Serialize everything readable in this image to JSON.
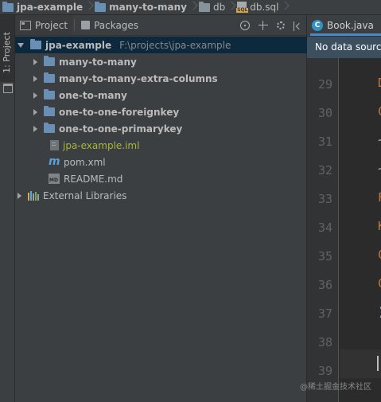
{
  "breadcrumb": {
    "items": [
      {
        "label": "jpa-example",
        "icon": "folder-icon",
        "bold": true
      },
      {
        "label": "many-to-many",
        "icon": "folder-icon",
        "bold": true
      },
      {
        "label": "db",
        "icon": "folder-icon",
        "bold": false
      },
      {
        "label": "db.sql",
        "icon": "sql-file-icon",
        "bold": false
      }
    ]
  },
  "left_stripe": {
    "project_label": "1: Project"
  },
  "project_panel": {
    "tabs": [
      {
        "label": "Project",
        "icon": "project-icon",
        "selected": true
      },
      {
        "label": "Packages",
        "icon": "packages-icon",
        "selected": false
      }
    ],
    "toolbar_icons": [
      "scroll-from-source-icon",
      "collapse-all-icon",
      "settings-gear-icon",
      "hide-panel-icon"
    ],
    "tree": [
      {
        "label": "jpa-example",
        "sub": "F:\\projects\\jpa-example",
        "icon": "module-folder-icon",
        "bold": true,
        "expanded": true
      },
      {
        "label": "many-to-many",
        "icon": "module-folder-icon",
        "bold": true,
        "expanded": false
      },
      {
        "label": "many-to-many-extra-columns",
        "icon": "module-folder-icon",
        "bold": true,
        "expanded": false
      },
      {
        "label": "one-to-many",
        "icon": "module-folder-icon",
        "bold": true,
        "expanded": false
      },
      {
        "label": "one-to-one-foreignkey",
        "icon": "module-folder-icon",
        "bold": true,
        "expanded": false
      },
      {
        "label": "one-to-one-primarykey",
        "icon": "module-folder-icon",
        "bold": true,
        "expanded": false
      },
      {
        "label": "jpa-example.iml",
        "icon": "iml-file-icon",
        "bold": false,
        "color": "#a9b43e"
      },
      {
        "label": "pom.xml",
        "icon": "maven-pom-icon",
        "bold": false
      },
      {
        "label": "README.md",
        "icon": "markdown-file-icon",
        "bold": false
      },
      {
        "label": "External Libraries",
        "icon": "libraries-icon",
        "bold": false,
        "expanded": false
      }
    ]
  },
  "editor": {
    "tab": {
      "label": "Book.java",
      "icon": "class-icon",
      "icon_letter": "C"
    },
    "notice": "No data sources",
    "line_numbers": [
      "29",
      "30",
      "31",
      "32",
      "33",
      "34",
      "35",
      "36",
      "37",
      "38",
      "39"
    ],
    "code_glyphs": [
      "D",
      "C",
      "~",
      "~",
      "F",
      "K",
      "C",
      "C",
      ")",
      "",
      ""
    ],
    "code_colors": [
      "#cc7832",
      "#cc7832",
      "#a9b7c6",
      "#a9b7c6",
      "#cc7832",
      "#cc7832",
      "#cc7832",
      "#cc7832",
      "#a9b7c6",
      "#a9b7c6",
      "#a9b7c6"
    ]
  },
  "watermark": "@稀土掘金技术社区",
  "colors": {
    "panel_bg": "#3c3f41",
    "editor_bg": "#2b2b2b",
    "selection": "#0d293e",
    "accent_tab": "#4a88c7",
    "notice_bg": "#3c4f5f"
  }
}
